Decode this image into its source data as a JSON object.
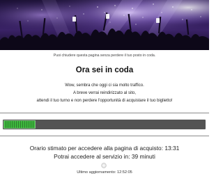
{
  "header": {
    "image": "concert-crowd-banner"
  },
  "queue": {
    "notice": "Puoi chiudere questa pagina senza perdere il tuo posto in coda.",
    "title": "Ora sei in coda",
    "message_line1": "Wow, sembra che oggi ci sia molto traffico.",
    "message_line2": "A breve verrai reindirizzato al sito,",
    "message_line3": "attendi il tuo turno e non perdere l'opportunità di acquistare il tuo biglietto!",
    "progress_fraction": 0.16,
    "eta_line": "Orario stimato per accedere alla pagina di acquisto: 13:31",
    "wait_line": "Potrai accedere al servizio in: 39 minuti",
    "last_update": "Ultimo aggiornamento: 12:52:05"
  },
  "colors": {
    "progress_fill": "#3cb83c",
    "progress_track": "#545454",
    "hero_purple": "#3a2266"
  }
}
